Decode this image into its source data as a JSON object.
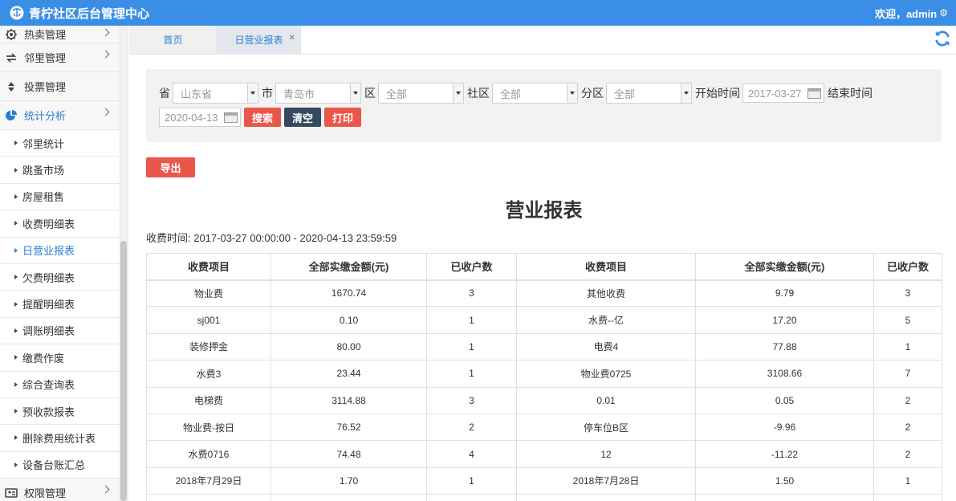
{
  "header": {
    "title": "青柠社区后台管理中心",
    "welcome": "欢迎，admin"
  },
  "sidebar": {
    "top_items": [
      {
        "label": "热卖管理",
        "icon": "gear-icon"
      },
      {
        "label": "邻里管理",
        "icon": "exchange-icon"
      },
      {
        "label": "投票管理",
        "icon": "sort-icon"
      },
      {
        "label": "统计分析",
        "icon": "pie-chart-icon"
      }
    ],
    "sub_items": [
      "邻里统计",
      "跳蚤市场",
      "房屋租售",
      "收费明细表",
      "日营业报表",
      "欠费明细表",
      "提醒明细表",
      "调账明细表",
      "缴费作废",
      "综合查询表",
      "预收款报表",
      "删除费用统计表",
      "设备台账汇总"
    ],
    "bottom_items": [
      {
        "label": "权限管理",
        "icon": "user-icon"
      }
    ]
  },
  "tabs": {
    "home": "首页",
    "report": "日营业报表"
  },
  "filter": {
    "province_label": "省",
    "province_value": "山东省",
    "city_label": "市",
    "city_value": "青岛市",
    "district_label": "区",
    "district_value": "全部",
    "community_label": "社区",
    "community_value": "全部",
    "subarea_label": "分区",
    "subarea_value": "全部",
    "start_label": "开始时间",
    "start_value": "2017-03-27",
    "end_label": "结束时间",
    "end_value": "2020-04-13",
    "search": "搜索",
    "clear": "清空",
    "print": "打印"
  },
  "export": "导出",
  "report": {
    "title": "营业报表",
    "period": "收费时间: 2017-03-27 00:00:00 - 2020-04-13 23:59:59",
    "columns": [
      "收费项目",
      "全部实缴金额(元)",
      "已收户数",
      "收费项目",
      "全部实缴金额(元)",
      "已收户数"
    ],
    "rows": [
      [
        "物业费",
        "1670.74",
        "3",
        "其他收费",
        "9.79",
        "3"
      ],
      [
        "sj001",
        "0.10",
        "1",
        "水费--亿",
        "17.20",
        "5"
      ],
      [
        "装修押金",
        "80.00",
        "1",
        "电费4",
        "77.88",
        "1"
      ],
      [
        "水费3",
        "23.44",
        "1",
        "物业费0725",
        "3108.66",
        "7"
      ],
      [
        "电梯费",
        "3114.88",
        "3",
        "0.01",
        "0.05",
        "2"
      ],
      [
        "物业费-按日",
        "76.52",
        "2",
        "停车位B区",
        "-9.96",
        "2"
      ],
      [
        "水费0716",
        "74.48",
        "4",
        "12",
        "-11.22",
        "2"
      ],
      [
        "2018年7月29日",
        "1.70",
        "1",
        "2018年7月28日",
        "1.50",
        "1"
      ],
      [
        "",
        "",
        "",
        "",
        "",
        ""
      ]
    ]
  }
}
